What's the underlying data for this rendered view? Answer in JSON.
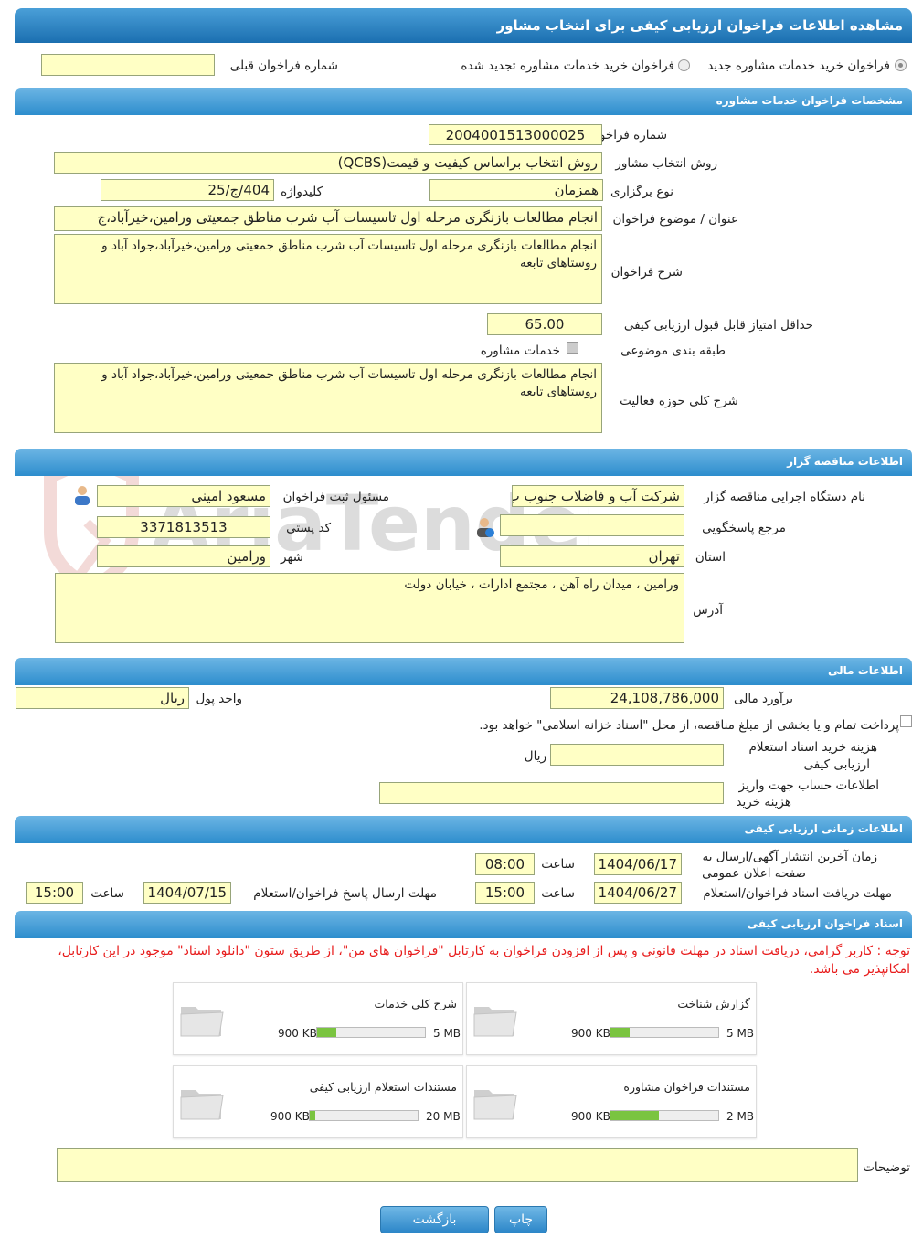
{
  "header": {
    "title": "مشاهده اطلاعات فراخوان ارزیابی کیفی برای انتخاب مشاور"
  },
  "top": {
    "radio1": "فراخوان خرید خدمات مشاوره جدید",
    "radio2": "فراخوان خرید خدمات مشاوره تجدید شده",
    "prev_label": "شماره فراخوان قبلی",
    "prev_value": ""
  },
  "s1": {
    "title": "مشخصات فراخوان خدمات مشاوره",
    "num_label": "شماره فراخوان",
    "num_value": "2004001513000025",
    "method_label": "روش انتخاب مشاور",
    "method_value": "روش انتخاب براساس کیفیت و قیمت(QCBS)",
    "type_label": "نوع برگزاری",
    "type_value": "همزمان",
    "key_label": "کلیدواژه",
    "key_value": "404/ج/25",
    "subject_label": "عنوان / موضوع فراخوان",
    "subject_value": "انجام مطالعات بازنگری مرحله اول تاسیسات آب شرب مناطق جمعیتی ورامین،خیرآباد،ج",
    "desc_label": "شرح فراخوان",
    "desc_value": "انجام مطالعات بازنگری مرحله اول تاسیسات آب شرب مناطق جمعیتی ورامین،خیرآباد،جواد آباد و روستاهای تابعه",
    "min_label": "حداقل امتیاز قابل قبول ارزیابی کیفی",
    "min_value": "65.00",
    "cat_label": "طبقه بندی موضوعی",
    "cat_value": "خدمات مشاوره",
    "scope_label": "شرح کلی حوزه فعالیت",
    "scope_value": "انجام مطالعات بازنگری مرحله اول تاسیسات آب شرب مناطق جمعیتی ورامین،خیرآباد،جواد آباد و روستاهای تابعه"
  },
  "s2": {
    "title": "اطلاعات مناقصه گزار",
    "org_label": "نام دستگاه اجرایی مناقصه گزار",
    "org_value": "شرکت آب و فاضلاب جنوب ب",
    "resp_label": "مسئول ثبت فراخوان",
    "resp_value": "مسعود امینی",
    "ref_label": "مرجع پاسخگویی",
    "ref_value": "",
    "postal_label": "کد پستی",
    "postal_value": "3371813513",
    "prov_label": "استان",
    "prov_value": "تهران",
    "city_label": "شهر",
    "city_value": "ورامین",
    "addr_label": "آدرس",
    "addr_value": "ورامین ، میدان راه آهن ، مجتمع ادارات ، خیابان دولت"
  },
  "s3": {
    "title": "اطلاعات مالی",
    "budget_label": "برآورد مالی",
    "budget_value": "24,108,786,000",
    "unit_label": "واحد پول",
    "unit_value": "ریال",
    "treasury_text": "پرداخت تمام و یا بخشی از مبلغ مناقصه، از محل \"اسناد خزانه اسلامی\" خواهد بود.",
    "fee_label1": "هزینه خرید اسناد استعلام",
    "fee_label2": "ارزیابی کیفی",
    "fee_value": "",
    "fee_unit": "ریال",
    "acc_label1": "اطلاعات حساب جهت واریز",
    "acc_label2": "هزینه خرید",
    "acc_value": ""
  },
  "s4": {
    "title": "اطلاعات زمانی ارزیابی کیفی",
    "pub_label1": "زمان آخرین انتشار آگهی/ارسال به",
    "pub_label2": "صفحه اعلان عمومی",
    "pub_date": "1404/06/17",
    "pub_time": "08:00",
    "recv_label": "مهلت دریافت اسناد فراخوان/استعلام",
    "recv_date": "1404/06/27",
    "recv_time": "15:00",
    "send_label": "مهلت ارسال پاسخ فراخوان/استعلام",
    "send_date": "1404/07/15",
    "send_time": "15:00",
    "time_label": "ساعت"
  },
  "s5": {
    "title": "اسناد فراخوان ارزیابی کیفی",
    "notice": "توجه : کاربر گرامی، دریافت اسناد در مهلت قانونی و پس از افزودن فراخوان به کارتابل \"فراخوان های من\"، از طریق ستون \"دانلود اسناد\" موجود در این کارتابل، امکانپذیر می باشد.",
    "docs": [
      {
        "title": "گزارش شناخت",
        "size": "900 KB",
        "max": "5 MB",
        "fill": 0.18
      },
      {
        "title": "شرح کلی خدمات",
        "size": "900 KB",
        "max": "5 MB",
        "fill": 0.18
      },
      {
        "title": "مستندات فراخوان مشاوره",
        "size": "900 KB",
        "max": "2 MB",
        "fill": 0.45
      },
      {
        "title": "مستندات استعلام ارزیابی کیفی",
        "size": "900 KB",
        "max": "20 MB",
        "fill": 0.05
      }
    ],
    "notes_label": "توضیحات",
    "notes_value": ""
  },
  "buttons": {
    "print": "چاپ",
    "back": "بازگشت"
  },
  "colors": {
    "header": "#1b6fb0",
    "section": "#3a95d4",
    "field": "#ffffc5",
    "notice": "#e81d1d",
    "progress": "#7ac440"
  },
  "watermark": "AriaTender.neT"
}
